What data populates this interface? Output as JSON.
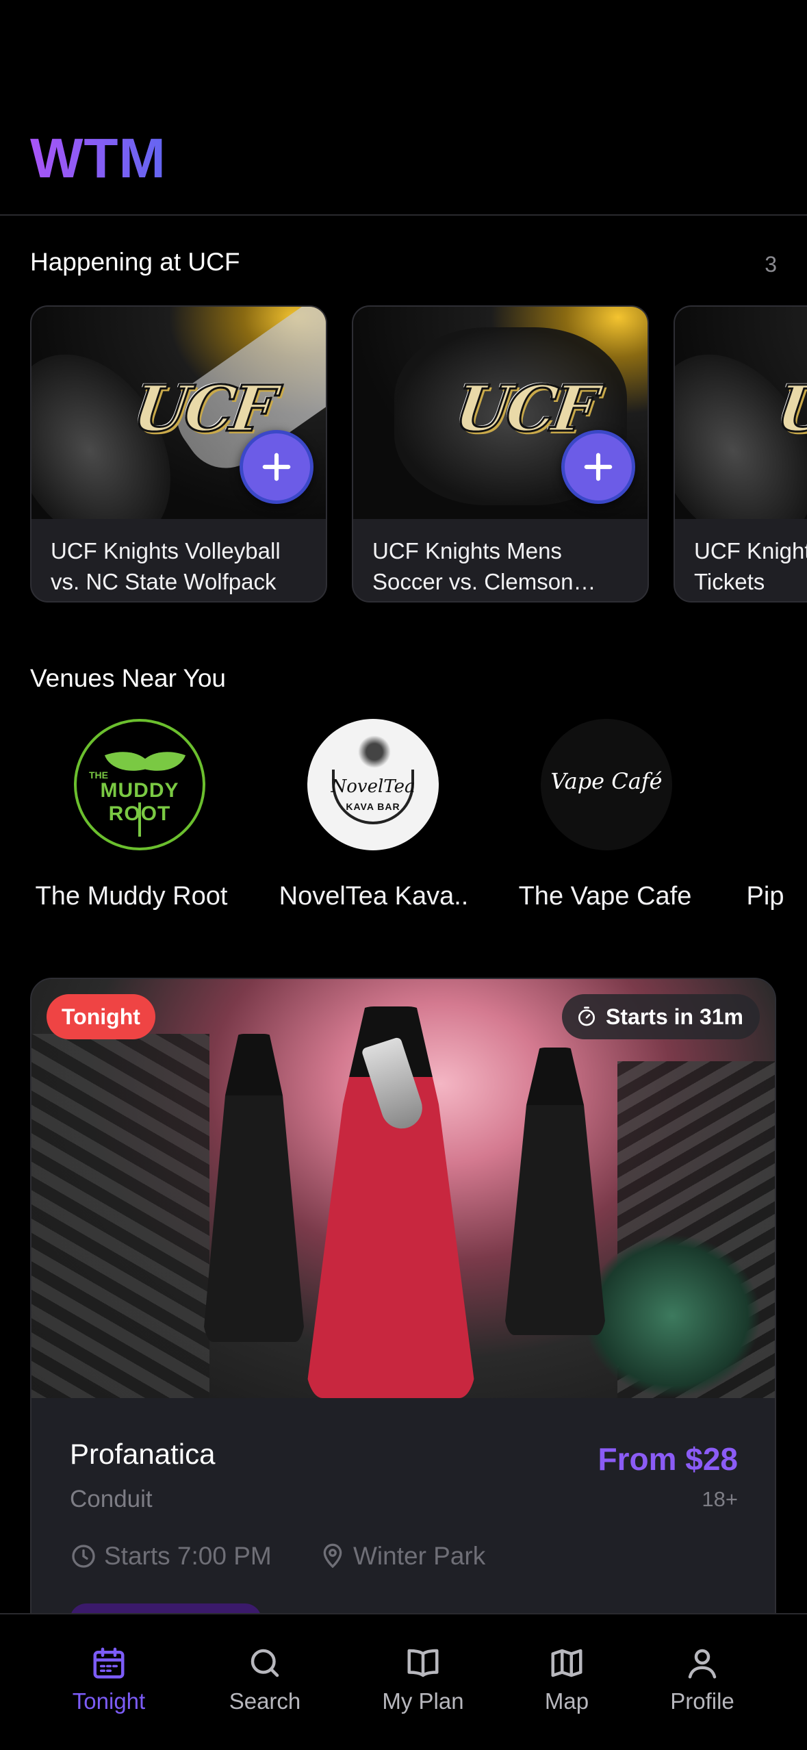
{
  "app": {
    "logo": "WTM"
  },
  "happening": {
    "title": "Happening at UCF",
    "count": "3",
    "cards": [
      {
        "title": "UCF Knights Volleyball vs. NC State Wolfpack",
        "logo_text": "UCF"
      },
      {
        "title": "UCF Knights Mens Soccer vs. Clemson Tigers",
        "logo_text": "UCF"
      },
      {
        "title": "UCF Knights Season Tickets",
        "logo_text": "UCF"
      }
    ]
  },
  "venues": {
    "title": "Venues Near You",
    "items": [
      {
        "name": "The Muddy Root",
        "logo_top": "THE",
        "logo_main": "MUDDY ROOT"
      },
      {
        "name": "NovelTea Kava..",
        "logo_main": "NovelTea",
        "logo_sub": "KAVA BAR"
      },
      {
        "name": "The Vape Cafe",
        "logo_main": "Vape Café"
      },
      {
        "name": "Pip"
      }
    ]
  },
  "featured_event": {
    "badge": "Tonight",
    "countdown": "Starts in 31m",
    "title": "Profanatica",
    "venue": "Conduit",
    "price": "From $28",
    "age": "18+",
    "time": "Starts 7:00 PM",
    "location": "Winter Park"
  },
  "tabs": [
    {
      "label": "Tonight",
      "icon": "calendar-icon",
      "active": true
    },
    {
      "label": "Search",
      "icon": "search-icon",
      "active": false
    },
    {
      "label": "My Plan",
      "icon": "book-icon",
      "active": false
    },
    {
      "label": "Map",
      "icon": "map-icon",
      "active": false
    },
    {
      "label": "Profile",
      "icon": "user-icon",
      "active": false
    }
  ],
  "colors": {
    "accent": "#7c5cf7",
    "tonight_badge": "#ef4444",
    "price": "#8b5cf6",
    "background": "#000000"
  }
}
